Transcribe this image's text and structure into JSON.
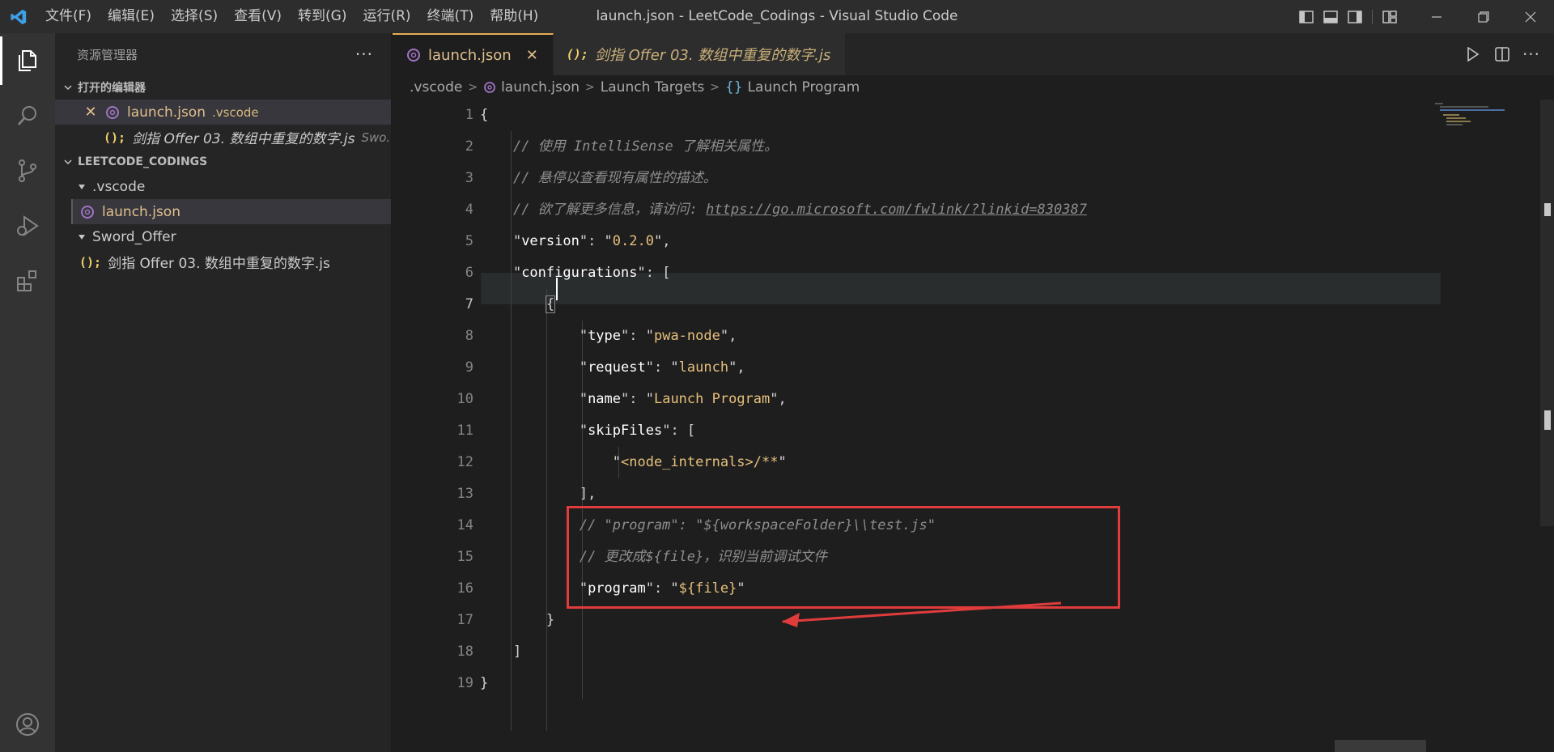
{
  "window": {
    "title": "launch.json - LeetCode_Codings - Visual Studio Code"
  },
  "menu": [
    "文件(F)",
    "编辑(E)",
    "选择(S)",
    "查看(V)",
    "转到(G)",
    "运行(R)",
    "终端(T)",
    "帮助(H)"
  ],
  "sidebar": {
    "title": "资源管理器",
    "more": "···",
    "open_editors": {
      "label": "打开的编辑器",
      "items": [
        {
          "close": "✕",
          "name": "launch.json",
          "desc": ".vscode"
        },
        {
          "name": "剑指 Offer 03. 数组中重复的数字.js",
          "desc": "Swo..."
        }
      ]
    },
    "workspace": {
      "label": "LEETCODE_CODINGS",
      "folders": [
        {
          "name": ".vscode",
          "files": [
            "launch.json"
          ]
        },
        {
          "name": "Sword_Offer",
          "files": [
            "剑指 Offer 03. 数组中重复的数字.js"
          ]
        }
      ]
    },
    "js_icon": "();"
  },
  "tabs": [
    {
      "label": "launch.json",
      "close": "✕"
    },
    {
      "label": "剑指 Offer 03. 数组中重复的数字.js"
    }
  ],
  "breadcrumb": [
    ".vscode",
    "launch.json",
    "Launch Targets",
    "Launch Program"
  ],
  "breadcrumb_braces": "{}",
  "gutter": [
    "1",
    "2",
    "3",
    "4",
    "5",
    "6",
    "7",
    "8",
    "9",
    "10",
    "11",
    "12",
    "13",
    "14",
    "15",
    "16",
    "17",
    "18",
    "19"
  ],
  "code": {
    "l1": "{",
    "l2": "// 使用 IntelliSense 了解相关属性。",
    "l3": "// 悬停以查看现有属性的描述。",
    "l4_prefix": "// 欲了解更多信息，请访问: ",
    "l4_url": "https://go.microsoft.com/fwlink/?linkid=830387",
    "l5_key": "version",
    "l5_val": "0.2.0",
    "l6_key": "configurations",
    "l6_rest": ": [",
    "l7": "{",
    "l8_key": "type",
    "l8_val": "pwa-node",
    "l9_key": "request",
    "l9_val": "launch",
    "l10_key": "name",
    "l10_val": "Launch Program",
    "l11_key": "skipFiles",
    "l11_rest": ": [",
    "l12_val": "<node_internals>/**",
    "l13": "],",
    "l14": "// \"program\": \"${workspaceFolder}\\\\test.js\"",
    "l15": "// 更改成${file}，识别当前调试文件",
    "l16_key": "program",
    "l16_val": "${file}",
    "l17": "}",
    "l18": "]",
    "l19": "}"
  },
  "colors": {
    "accent_tab_border": "#e8ab53",
    "annotation": "#e03c3c",
    "string": "#e6c07b",
    "comment": "#8d8d8d"
  }
}
